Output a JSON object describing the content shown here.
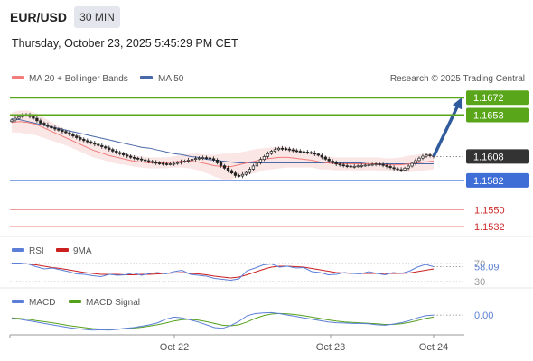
{
  "header": {
    "symbol": "EUR/USD",
    "timeframe": "30 MIN",
    "datetime": "Thursday, October 23, 2025 5:45:29 PM CET"
  },
  "legend": {
    "ma20": "MA 20 + Bollinger Bands",
    "ma50": "MA 50",
    "source": "Research © 2025 Trading Central",
    "rsi": "RSI",
    "rsi_ma": "9MA",
    "macd": "MACD",
    "macd_signal": "MACD Signal"
  },
  "colors": {
    "up_level": "#5aa61a",
    "down_level": "#3f6fd6",
    "support_minor": "#e55a5a",
    "current": "#333333",
    "candle": "#222222",
    "ma20": "#f27b7b",
    "ma50": "#4a69a8",
    "band_fill": "#f9d6d6",
    "arrow": "#2f5b9c",
    "rsi": "#5b7fd6",
    "rsi_ma": "#cc1f1f",
    "macd": "#5b7fd6",
    "macd_signal": "#55a11d"
  },
  "chart_data": {
    "type": "candlestick",
    "instrument": "EUR/USD",
    "interval": "30 MIN",
    "ylim": [
      1.1525,
      1.168
    ],
    "x_ticks": [
      "Oct 22",
      "Oct 23",
      "Oct 24"
    ],
    "current_price": 1.1608,
    "levels": [
      {
        "label": "1.1672",
        "value": 1.1672,
        "kind": "target"
      },
      {
        "label": "1.1653",
        "value": 1.1653,
        "kind": "target"
      },
      {
        "label": "1.1608",
        "value": 1.1608,
        "kind": "current"
      },
      {
        "label": "1.1582",
        "value": 1.1582,
        "kind": "pivot"
      },
      {
        "label": "1.1550",
        "value": 1.155,
        "kind": "support"
      },
      {
        "label": "1.1532",
        "value": 1.1532,
        "kind": "support"
      }
    ],
    "price_path": [
      1.1646,
      1.165,
      1.1654,
      1.165,
      1.1644,
      1.164,
      1.1637,
      1.1634,
      1.163,
      1.1626,
      1.1623,
      1.162,
      1.1617,
      1.1613,
      1.161,
      1.1607,
      1.1605,
      1.1603,
      1.1601,
      1.16,
      1.16,
      1.1602,
      1.1604,
      1.1606,
      1.1607,
      1.1605,
      1.1598,
      1.1592,
      1.1586,
      1.159,
      1.1598,
      1.1606,
      1.1613,
      1.1617,
      1.1616,
      1.1614,
      1.1613,
      1.1612,
      1.1609,
      1.1604,
      1.16,
      1.1598,
      1.1597,
      1.1598,
      1.1599,
      1.16,
      1.1598,
      1.1595,
      1.1593,
      1.1598,
      1.1605,
      1.161,
      1.1608
    ],
    "ma20_path": [
      1.1645,
      1.1646,
      1.1645,
      1.1643,
      1.1639,
      1.1635,
      1.1631,
      1.1627,
      1.1623,
      1.1619,
      1.1615,
      1.1612,
      1.1609,
      1.1607,
      1.1605,
      1.1603,
      1.1602,
      1.1601,
      1.1601,
      1.1601,
      1.1602,
      1.1603,
      1.1603,
      1.1602,
      1.16,
      1.1598,
      1.1597,
      1.1597,
      1.1599,
      1.1601,
      1.1603,
      1.1605,
      1.1606,
      1.1607,
      1.1607,
      1.1606,
      1.1605,
      1.1604,
      1.1602,
      1.1601,
      1.16,
      1.16,
      1.16,
      1.16,
      1.16,
      1.16,
      1.1599,
      1.1599,
      1.1599,
      1.16,
      1.1601,
      1.1602,
      1.1603
    ],
    "ma50_path": [
      1.1649,
      1.1648,
      1.1646,
      1.1644,
      1.1642,
      1.164,
      1.1638,
      1.1636,
      1.1634,
      1.1632,
      1.163,
      1.1628,
      1.1626,
      1.1624,
      1.1622,
      1.162,
      1.1618,
      1.1617,
      1.1615,
      1.1613,
      1.1611,
      1.161,
      1.1608,
      1.1607,
      1.1605,
      1.1604,
      1.1603,
      1.1602,
      1.1601,
      1.1601,
      1.1601,
      1.1601,
      1.1601,
      1.1601,
      1.1601,
      1.1601,
      1.1601,
      1.1601,
      1.1601,
      1.1601,
      1.1601,
      1.1601,
      1.1601,
      1.1601,
      1.16,
      1.16,
      1.16,
      1.16,
      1.16,
      1.16,
      1.16,
      1.16,
      1.16
    ],
    "band_halfwidth": [
      0.0011,
      0.0012,
      0.0013,
      0.0012,
      0.0011,
      0.001,
      0.0009,
      0.0008,
      0.0008,
      0.0008,
      0.0008,
      0.0007,
      0.0007,
      0.0007,
      0.0006,
      0.0006,
      0.0006,
      0.0006,
      0.0006,
      0.0006,
      0.0006,
      0.0007,
      0.0008,
      0.0009,
      0.001,
      0.0012,
      0.0014,
      0.0014,
      0.0013,
      0.0013,
      0.0013,
      0.0012,
      0.0012,
      0.0012,
      0.0011,
      0.001,
      0.0009,
      0.0008,
      0.0008,
      0.0007,
      0.0007,
      0.0007,
      0.0007,
      0.0007,
      0.0007,
      0.0007,
      0.0007,
      0.0007,
      0.0008,
      0.0009,
      0.0009,
      0.0009,
      0.0009
    ],
    "forecast": {
      "from": 1.1608,
      "to": 1.1672
    },
    "rsi": {
      "value": "58.09",
      "levels": [
        "70",
        "30"
      ],
      "ylim": [
        20,
        80
      ],
      "path": [
        71,
        71,
        69,
        63,
        58,
        60,
        56,
        52,
        47,
        46,
        43,
        41,
        46,
        44,
        45,
        49,
        44,
        48,
        50,
        47,
        52,
        55,
        46,
        44,
        42,
        37,
        35,
        33,
        36,
        54,
        60,
        67,
        69,
        62,
        64,
        60,
        61,
        52,
        50,
        45,
        46,
        50,
        48,
        47,
        52,
        48,
        45,
        50,
        48,
        53,
        62,
        68,
        63
      ],
      "ma_path": [
        70,
        70,
        69,
        67,
        64,
        61,
        59,
        56,
        53,
        50,
        48,
        46,
        46,
        46,
        45,
        45,
        46,
        46,
        47,
        48,
        49,
        50,
        48,
        47,
        45,
        42,
        40,
        38,
        40,
        45,
        51,
        57,
        62,
        64,
        64,
        63,
        62,
        59,
        56,
        53,
        50,
        49,
        48,
        48,
        48,
        48,
        48,
        48,
        48,
        49,
        52,
        55,
        58
      ]
    },
    "macd": {
      "value": "0.00",
      "ylim": [
        -1,
        1
      ],
      "macd_path": [
        0.1,
        0.05,
        -0.05,
        -0.15,
        -0.25,
        -0.35,
        -0.45,
        -0.55,
        -0.62,
        -0.68,
        -0.72,
        -0.7,
        -0.72,
        -0.68,
        -0.6,
        -0.55,
        -0.45,
        -0.35,
        -0.2,
        0.05,
        0.2,
        0.15,
        0.0,
        -0.15,
        -0.35,
        -0.55,
        -0.6,
        -0.4,
        -0.1,
        0.3,
        0.45,
        0.5,
        0.52,
        0.45,
        0.35,
        0.25,
        0.15,
        0.05,
        -0.05,
        -0.15,
        -0.2,
        -0.22,
        -0.25,
        -0.25,
        -0.28,
        -0.35,
        -0.38,
        -0.3,
        -0.2,
        -0.05,
        0.15,
        0.3,
        0.35
      ],
      "signal_path": [
        0.15,
        0.1,
        0.05,
        -0.05,
        -0.12,
        -0.2,
        -0.3,
        -0.4,
        -0.48,
        -0.55,
        -0.62,
        -0.65,
        -0.67,
        -0.65,
        -0.62,
        -0.58,
        -0.52,
        -0.44,
        -0.34,
        -0.22,
        -0.08,
        0.02,
        0.04,
        -0.02,
        -0.12,
        -0.25,
        -0.38,
        -0.42,
        -0.35,
        -0.15,
        0.1,
        0.3,
        0.42,
        0.46,
        0.44,
        0.38,
        0.3,
        0.2,
        0.1,
        0.0,
        -0.08,
        -0.14,
        -0.18,
        -0.21,
        -0.24,
        -0.28,
        -0.32,
        -0.32,
        -0.28,
        -0.18,
        -0.05,
        0.1,
        0.2
      ]
    }
  }
}
